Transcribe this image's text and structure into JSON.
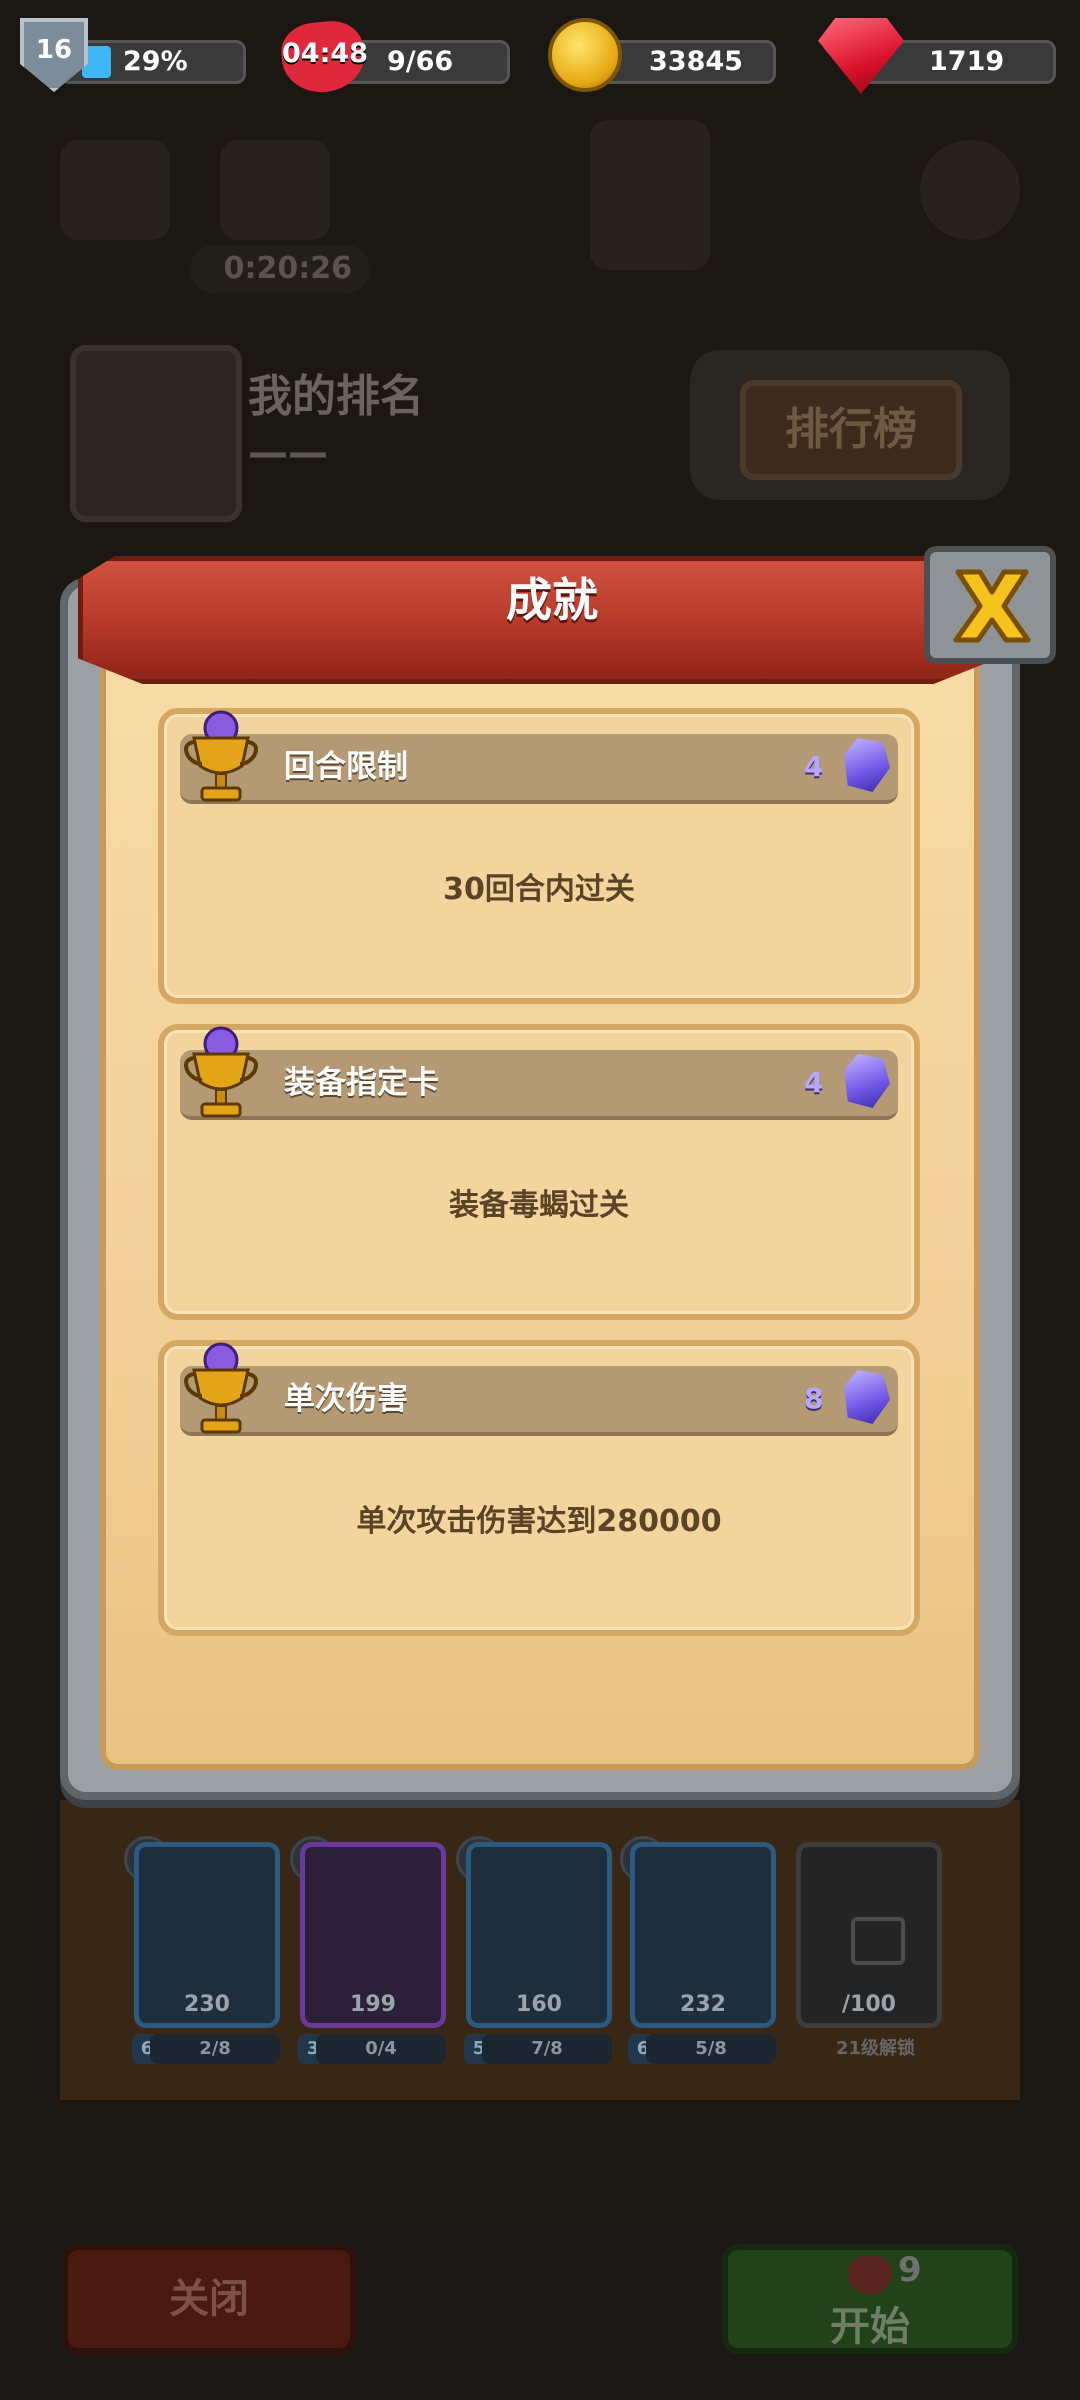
{
  "hud": {
    "level": "16",
    "xp_percent_label": "29%",
    "xp_fraction": 0.29,
    "heart_timer": "04:48",
    "energy": "9/66",
    "coins": "33845",
    "gems": "1719"
  },
  "background": {
    "timer": "0:20:26",
    "my_rank_title": "我的排名",
    "my_rank_value": "——",
    "leaderboard_button": "排行榜"
  },
  "dialog": {
    "title": "成就",
    "achievements": [
      {
        "title": "回合限制",
        "reward": "4",
        "description": "30回合内过关"
      },
      {
        "title": "装备指定卡",
        "reward": "4",
        "description": "装备毒蝎过关"
      },
      {
        "title": "单次伤害",
        "reward": "8",
        "description": "单次攻击伤害达到280000"
      }
    ]
  },
  "heroes": [
    {
      "power": "230",
      "level": "6",
      "progress": "2/8"
    },
    {
      "power": "199",
      "level": "3",
      "progress": "0/4"
    },
    {
      "power": "160",
      "level": "5",
      "progress": "7/8"
    },
    {
      "power": "232",
      "level": "6",
      "progress": "5/8"
    }
  ],
  "locked_slot": {
    "cost": "/100",
    "unlock_text": "21级解锁"
  },
  "buttons": {
    "close": "关闭",
    "start": "开始",
    "start_cost": "9"
  },
  "colors": {
    "ribbon": "#b23628",
    "parchment": "#f3d49c",
    "crystal": "#6f57e6",
    "xp_bar": "#3fb7f5"
  }
}
